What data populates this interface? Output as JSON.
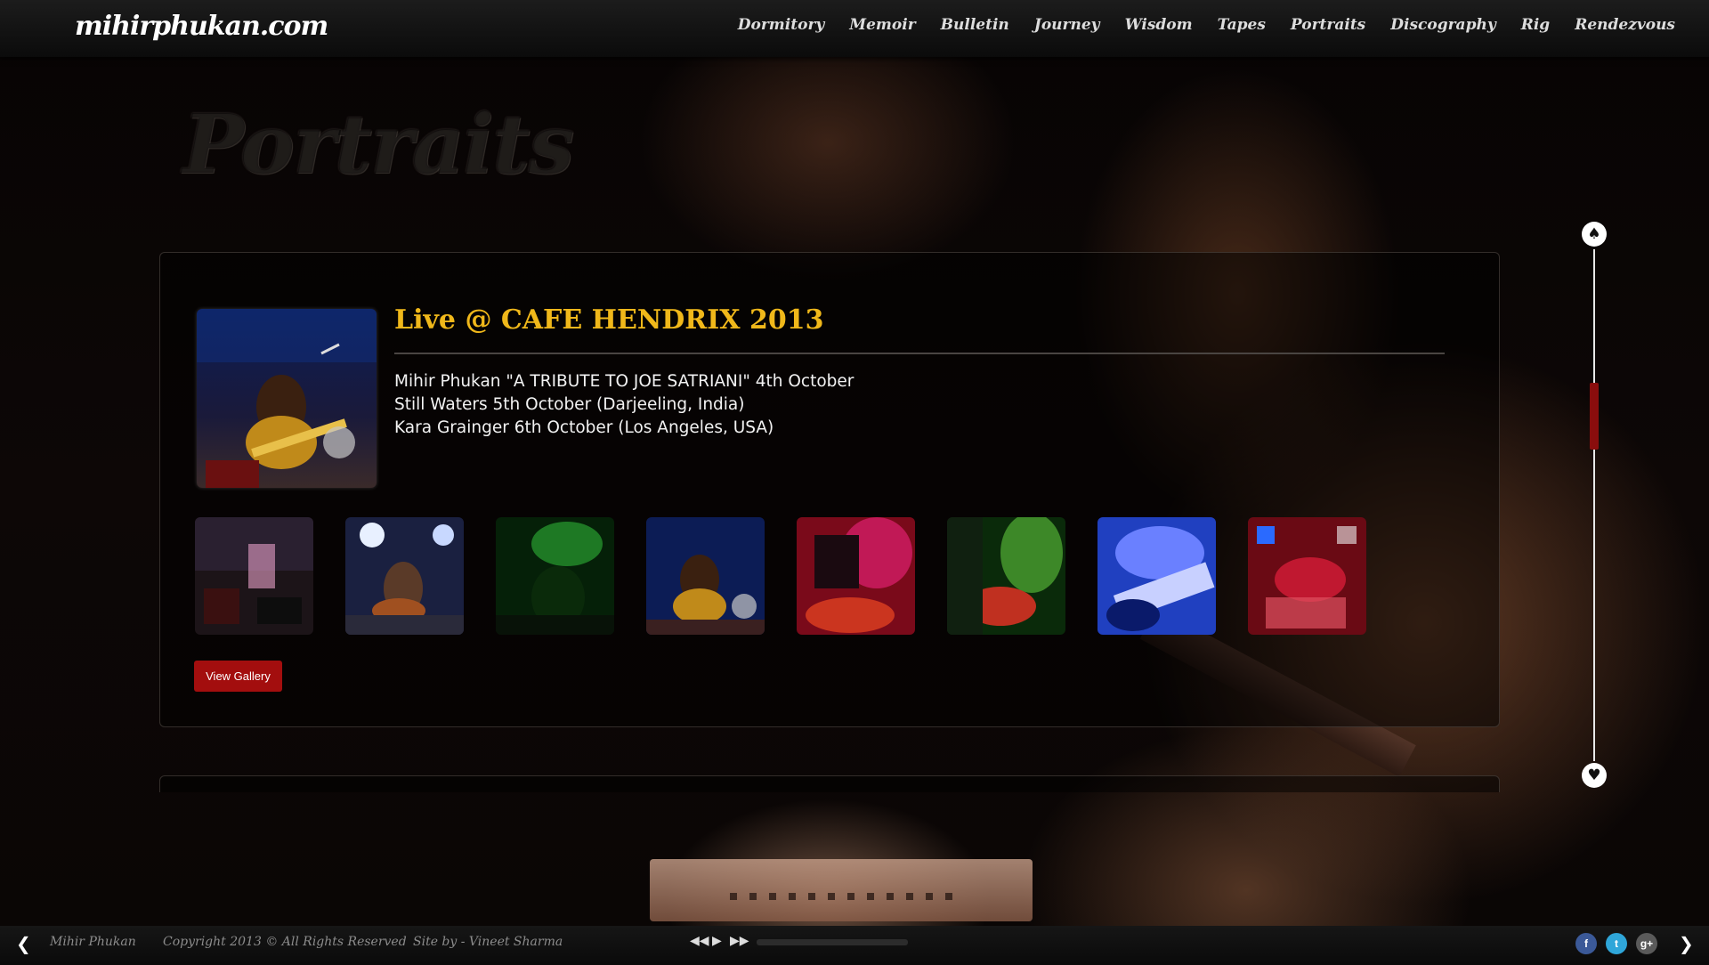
{
  "site": {
    "logo": "mihirphukan.com"
  },
  "nav": {
    "items": [
      "Dormitory",
      "Memoir",
      "Bulletin",
      "Journey",
      "Wisdom",
      "Tapes",
      "Portraits",
      "Discography",
      "Rig",
      "Rendezvous"
    ]
  },
  "page": {
    "title": "Portraits"
  },
  "event": {
    "title": "Live @ CAFE HENDRIX 2013",
    "lines": [
      "Mihir Phukan \"A TRIBUTE TO JOE SATRIANI\" 4th October",
      "Still Waters 5th October (Darjeeling, India)",
      "Kara Grainger 6th October (Los Angeles, USA)"
    ],
    "gallery_button": "View Gallery"
  },
  "footer": {
    "name": "Mihir Phukan",
    "copyright": "Copyright 2013 © All Rights Reserved",
    "credit": "Site by - Vineet Sharma"
  },
  "colors": {
    "accent_gold": "#f0b81a",
    "button_red": "#a30e0e",
    "facebook": "#3b5998",
    "twitter": "#2fa6d9",
    "googleplus": "#5a5a5a"
  },
  "icons": {
    "up": "spade-up-icon",
    "down": "spade-down-icon",
    "prev": "chevron-left-icon",
    "next": "chevron-right-icon",
    "rewind": "rewind-icon",
    "play": "play-icon",
    "forward": "fast-forward-icon"
  }
}
